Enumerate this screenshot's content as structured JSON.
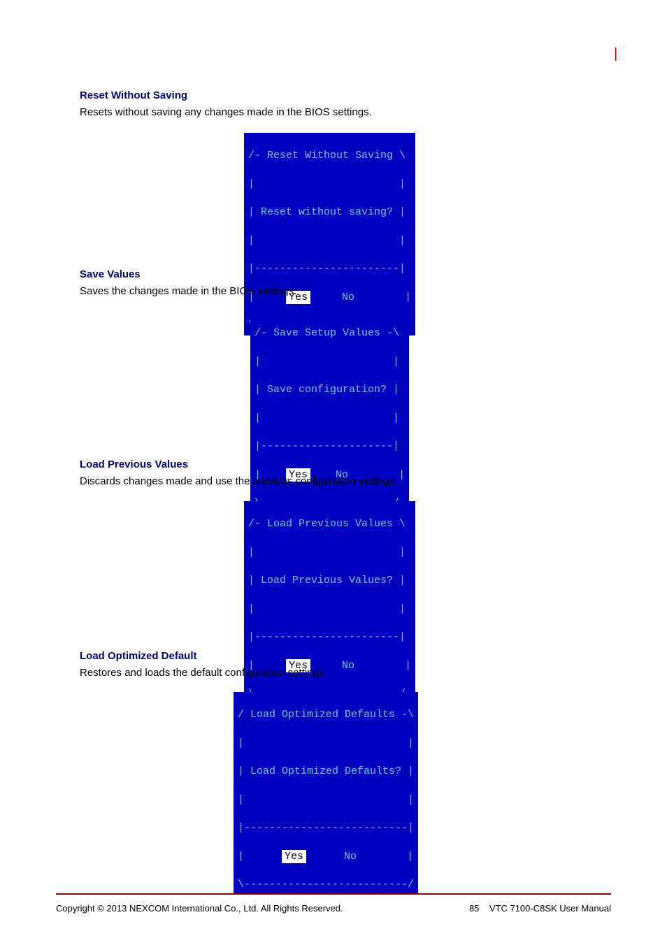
{
  "footer": {
    "left": "Copyright © 2013 NEXCOM International Co., Ltd. All Rights Reserved.",
    "right_label": "VTC 7100-C8SK User Manual",
    "page_num": "85"
  },
  "sections": [
    {
      "title": "Reset Without Saving",
      "body": "Resets without saving any changes made in the BIOS settings.",
      "dialog": {
        "head": "/- Reset Without Saving \\",
        "empty": "|                       |",
        "msg": "| Reset without saving? |",
        "sep": "|-----------------------|",
        "foot": "\\-----------------------/",
        "yes": "Yes",
        "no": "No"
      }
    },
    {
      "title": "Save Values",
      "body": "Saves the changes made in the BIOS settings.",
      "dialog": {
        "head": "/- Save Setup Values -\\",
        "empty": "|                     |",
        "msg": "| Save configuration? |",
        "sep": "|---------------------|",
        "foot": "\\---------------------/",
        "yes": "Yes",
        "no": "No"
      }
    },
    {
      "title": "Load Previous Values",
      "body": "Discards changes made and use the previous configuration settings.",
      "dialog": {
        "head": "/- Load Previous Values \\",
        "empty": "|                       |",
        "msg": "| Load Previous Values? |",
        "sep": "|-----------------------|",
        "foot": "\\-----------------------/",
        "yes": "Yes",
        "no": "No"
      }
    },
    {
      "title": "Load Optimized Default",
      "body": "Restores and loads the default configuration settings.",
      "dialog": {
        "head": "/ Load Optimized Defaults -\\",
        "empty": "|                          |",
        "msg": "| Load Optimized Defaults? |",
        "sep": "|--------------------------|",
        "foot": "\\--------------------------/",
        "yes": "Yes",
        "no": "No"
      }
    }
  ]
}
